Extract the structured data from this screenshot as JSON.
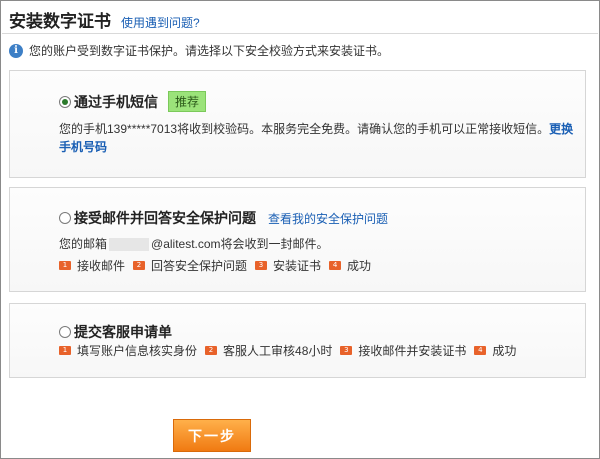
{
  "header": {
    "title": "安装数字证书",
    "help_link": "使用遇到问题?"
  },
  "intro": {
    "text": "您的账户受到数字证书保护。请选择以下安全校验方式来安装证书。"
  },
  "options": [
    {
      "title": "通过手机短信",
      "selected": true,
      "badge": "推荐",
      "desc_before": "您的手机139*****7013将收到校验码。本服务完全免费。请确认您的手机可以正常接收短信。",
      "desc_link": "更换手机号码"
    },
    {
      "title": "接受邮件并回答安全保护问题",
      "selected": false,
      "link": "查看我的安全保护问题",
      "desc_before": "您的邮箱",
      "desc_after": "@alitest.com将会收到一封邮件。",
      "steps": [
        {
          "num": "1",
          "label": "接收邮件"
        },
        {
          "num": "2",
          "label": "回答安全保护问题"
        },
        {
          "num": "3",
          "label": "安装证书"
        },
        {
          "num": "4",
          "label": "成功"
        }
      ]
    },
    {
      "title": "提交客服申请单",
      "selected": false,
      "steps": [
        {
          "num": "1",
          "label": "填写账户信息核实身份"
        },
        {
          "num": "2",
          "label": "客服人工审核48小时"
        },
        {
          "num": "3",
          "label": "接收邮件并安装证书"
        },
        {
          "num": "4",
          "label": "成功"
        }
      ]
    }
  ],
  "footer": {
    "next_label": "下一步"
  },
  "colors": {
    "link": "#1a5fb4",
    "badge_bg": "#9be37a",
    "step_badge": "#e8622a",
    "button": "#f07a12"
  }
}
